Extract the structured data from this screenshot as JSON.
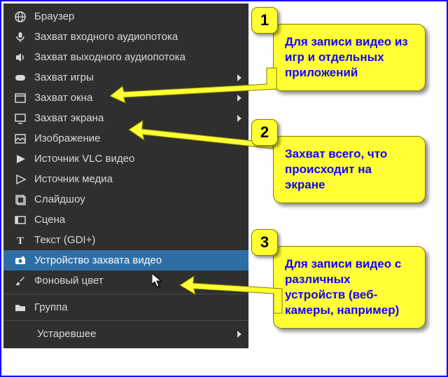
{
  "menu": {
    "items": [
      {
        "label": "Браузер"
      },
      {
        "label": "Захват входного аудиопотока"
      },
      {
        "label": "Захват выходного аудиопотока"
      },
      {
        "label": "Захват игры"
      },
      {
        "label": "Захват окна"
      },
      {
        "label": "Захват экрана"
      },
      {
        "label": "Изображение"
      },
      {
        "label": "Источник VLC видео"
      },
      {
        "label": "Источник медиа"
      },
      {
        "label": "Слайдшоу"
      },
      {
        "label": "Сцена"
      },
      {
        "label": "Текст (GDI+)"
      },
      {
        "label": "Устройство захвата видео"
      },
      {
        "label": "Фоновый цвет"
      },
      {
        "label": "Группа"
      },
      {
        "label": "Устаревшее"
      }
    ]
  },
  "callouts": [
    {
      "num": "1",
      "text": "Для записи видео из игр и отдельных приложений"
    },
    {
      "num": "2",
      "text": "Захват всего, что происходит на экране"
    },
    {
      "num": "3",
      "text": "Для записи видео с различных устройств (веб-камеры, например)"
    }
  ]
}
